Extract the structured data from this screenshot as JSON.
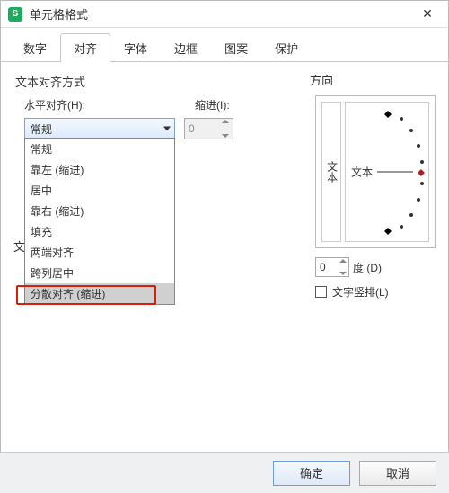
{
  "titlebar": {
    "icon_label": "S",
    "title": "单元格格式",
    "close": "✕"
  },
  "tabs": [
    "数字",
    "对齐",
    "字体",
    "边框",
    "图案",
    "保护"
  ],
  "active_tab_index": 1,
  "align": {
    "section_title": "文本对齐方式",
    "h_label": "水平对齐(H):",
    "indent_label": "缩进(I):",
    "h_value": "常规",
    "indent_value": "0",
    "h_options": [
      "常规",
      "靠左 (缩进)",
      "居中",
      "靠右 (缩进)",
      "填充",
      "两端对齐",
      "跨列居中",
      "分散对齐 (缩进)"
    ],
    "highlighted_option_index": 7
  },
  "text_control": {
    "partial_char": "文"
  },
  "orientation": {
    "section_title": "方向",
    "vertical_text": "文本",
    "dial_text": "文本",
    "degree_value": "0",
    "degree_label": "度 (D)",
    "vertical_checkbox_label": "文字竖排(L)",
    "vertical_checked": false
  },
  "footer": {
    "ok": "确定",
    "cancel": "取消"
  }
}
